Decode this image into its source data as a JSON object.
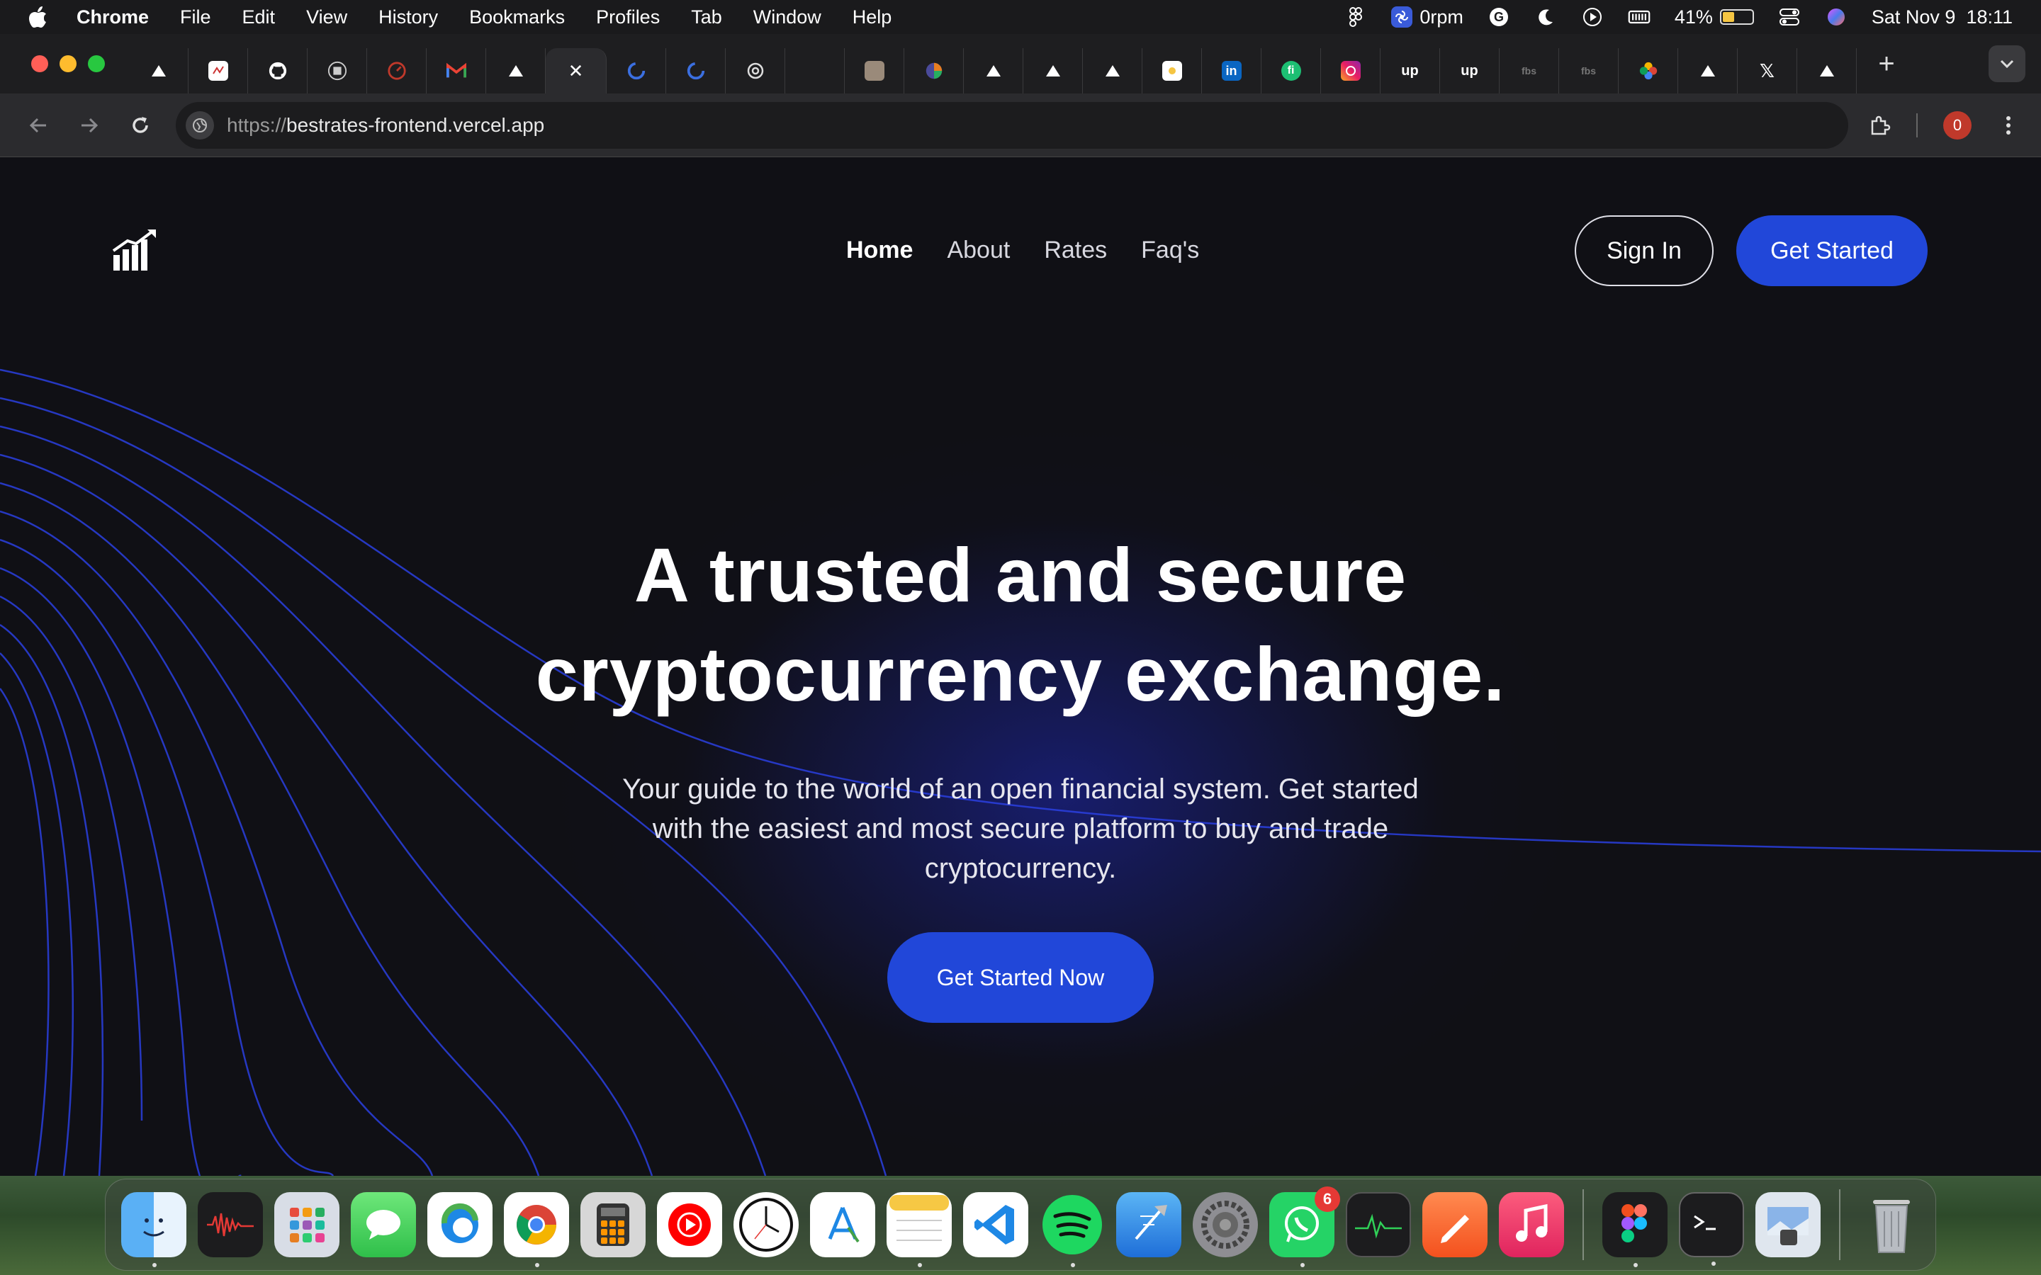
{
  "menubar": {
    "app": "Chrome",
    "items": [
      "File",
      "Edit",
      "View",
      "History",
      "Bookmarks",
      "Profiles",
      "Tab",
      "Window",
      "Help"
    ],
    "status": {
      "rpm": "0rpm",
      "battery": "41%",
      "battery_level": 0.41,
      "datetime": "Sat Nov 9  18:11"
    }
  },
  "browser": {
    "url_scheme": "https://",
    "url_host": "bestrates-frontend.vercel.app",
    "profile_badge": "0",
    "tabs": [
      {
        "icon": "drive-icon"
      },
      {
        "icon": "lucid-icon"
      },
      {
        "icon": "github-icon"
      },
      {
        "icon": "framer-icon"
      },
      {
        "icon": "speed-icon"
      },
      {
        "icon": "gmail-icon"
      },
      {
        "icon": "drive-icon"
      },
      {
        "icon": "close-icon",
        "active": true
      },
      {
        "icon": "loader-icon"
      },
      {
        "icon": "loader-icon"
      },
      {
        "icon": "openai-icon"
      },
      {
        "icon": "blank-icon"
      },
      {
        "icon": "photo-icon"
      },
      {
        "icon": "colorwheel-icon"
      },
      {
        "icon": "drive-icon"
      },
      {
        "icon": "drive-icon"
      },
      {
        "icon": "drive-icon"
      },
      {
        "icon": "note-icon"
      },
      {
        "icon": "linkedin-icon"
      },
      {
        "icon": "fiverr-icon"
      },
      {
        "icon": "instagram-icon"
      },
      {
        "icon": "upwork-icon"
      },
      {
        "icon": "upwork-icon"
      },
      {
        "icon": "fbs-icon"
      },
      {
        "icon": "fbs-icon"
      },
      {
        "icon": "photos-icon"
      },
      {
        "icon": "drive-icon"
      },
      {
        "icon": "x-icon"
      },
      {
        "icon": "drive-icon"
      }
    ],
    "tab_text": {
      "linkedin": "in",
      "fiverr": "fi",
      "upwork": "up",
      "x": "𝕏",
      "close": "✕"
    }
  },
  "site": {
    "nav": {
      "home": "Home",
      "about": "About",
      "rates": "Rates",
      "faq": "Faq's"
    },
    "sign_in": "Sign In",
    "get_started": "Get Started",
    "hero": {
      "title_line1": "A trusted and secure",
      "title_line2": "cryptocurrency exchange.",
      "subtitle": "Your guide to the world of an open financial system. Get started with the easiest and most secure platform to buy and trade cryptocurrency.",
      "cta": "Get Started Now"
    },
    "accent_color": "#2147d9",
    "bg_color": "#101015"
  },
  "dock": {
    "whatsapp_badge": "6",
    "apps": [
      "finder-icon",
      "voice-memos-icon",
      "launchpad-icon",
      "messages-icon",
      "edge-icon",
      "chrome-icon",
      "calculator-icon",
      "youtube-music-icon",
      "clock-icon",
      "app-store-icon",
      "notes-icon",
      "vscode-icon",
      "spotify-icon",
      "xcode-icon",
      "system-settings-icon",
      "whatsapp-icon",
      "activity-monitor-icon",
      "pen-icon",
      "music-icon",
      "figma-icon",
      "terminal-icon",
      "preview-icon",
      "trash-icon"
    ]
  }
}
